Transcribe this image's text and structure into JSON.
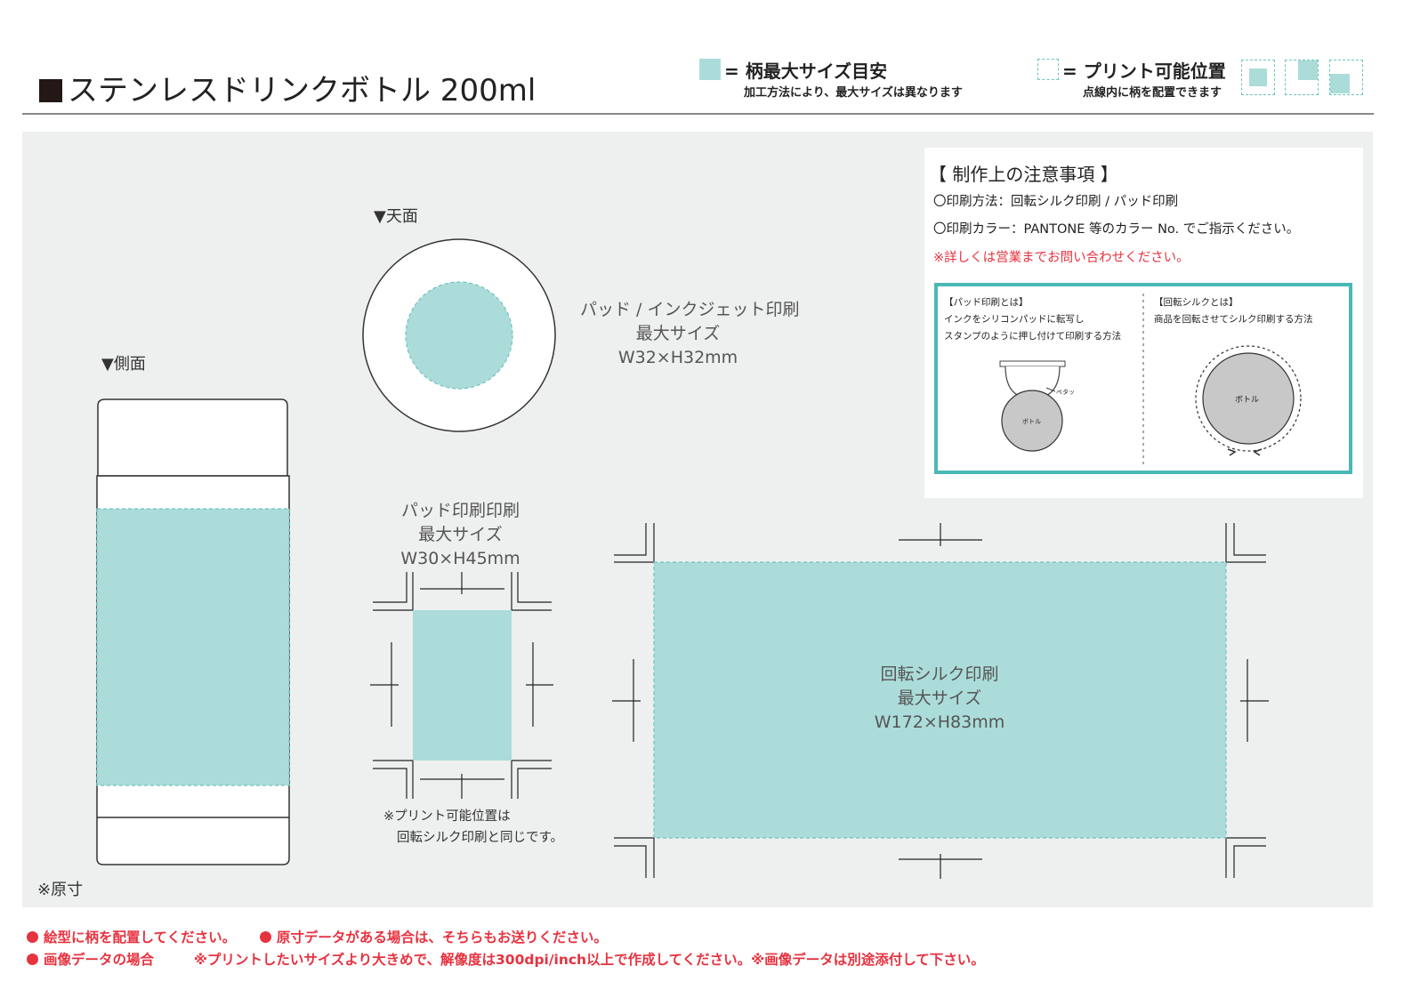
{
  "header": {
    "title": "ステンレスドリンクボトル 200ml",
    "legend_max": {
      "label": "= 柄最大サイズ目安",
      "sub": "加工方法により、最大サイズは異なります"
    },
    "legend_print": {
      "label": "= プリント可能位置",
      "sub": "点線内に柄を配置できます"
    }
  },
  "views": {
    "top_label": "▼天面",
    "side_label": "▼側面",
    "original_size_note": "※原寸"
  },
  "pad_inkjet": {
    "line1": "パッド / インクジェット印刷",
    "line2": "最大サイズ",
    "line3": "W32×H32mm"
  },
  "pad_print": {
    "line1": "パッド印刷印刷",
    "line2": "最大サイズ",
    "line3": "W30×H45mm",
    "note1": "※プリント可能位置は",
    "note2": "回転シルク印刷と同じです。"
  },
  "rotary_silk": {
    "line1": "回転シルク印刷",
    "line2": "最大サイズ",
    "line3": "W172×H83mm"
  },
  "notes": {
    "heading": "【 制作上の注意事項 】",
    "method": "〇印刷方法：回転シルク印刷 / パッド印刷",
    "color": "〇印刷カラー：PANTONE 等のカラー No. でご指示ください。",
    "contact": "※詳しくは営業までお問い合わせください。",
    "pad_title": "【パッド印刷とは】",
    "pad_desc1": "インクをシリコンパッドに転写し",
    "pad_desc2": "スタンプのように押し付けて印刷する方法",
    "pad_tag": "ペタッ",
    "bottle_label": "ボトル",
    "silk_title": "【回転シルクとは】",
    "silk_desc": "商品を回転させてシルク印刷する方法",
    "silk_bottle_label": "ボトル"
  },
  "footer": {
    "line1_a": "絵型に柄を配置してください。",
    "line1_b": "原寸データがある場合は、そちらもお送りください。",
    "line2_a": "画像データの場合",
    "line2_b": "※プリントしたいサイズより大きめで、解像度は300dpi/inch以上で作成してください。※画像データは別途添付して下さい。"
  },
  "colors": {
    "accent_fill": "#abdcd9",
    "accent_border": "#4ab8b4",
    "warning": "#e63340",
    "panel_bg": "#eef0ef"
  }
}
